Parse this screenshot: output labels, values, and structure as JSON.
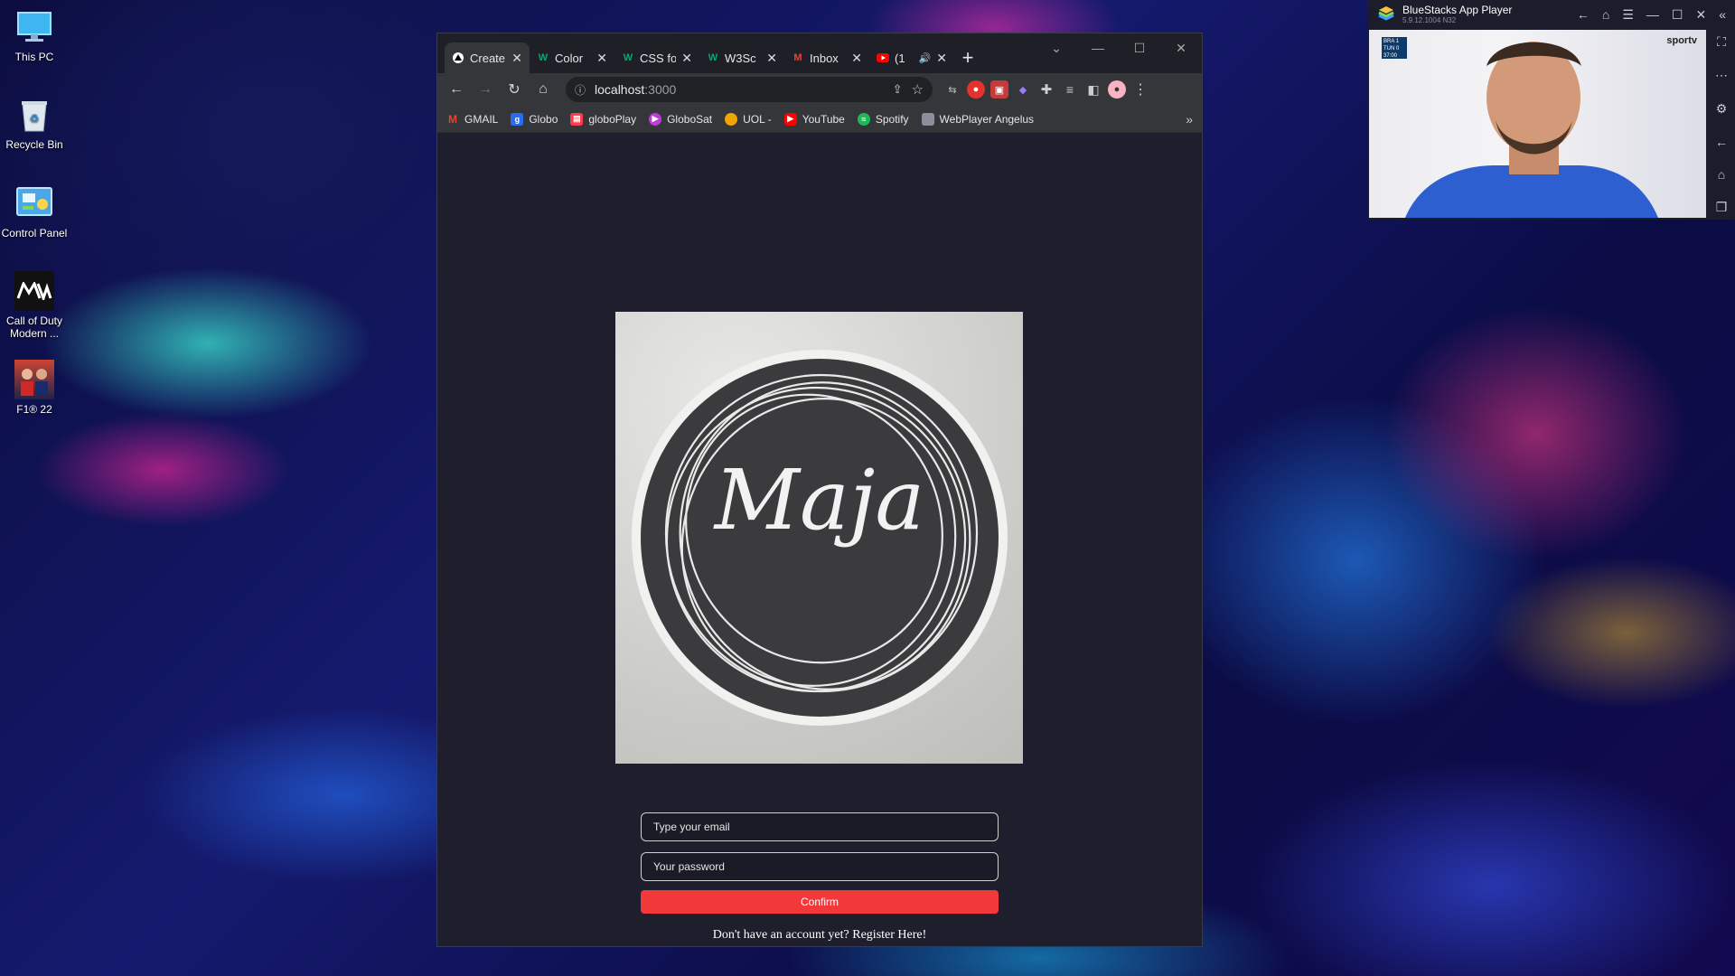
{
  "desktop": {
    "icons": [
      {
        "label": "This PC",
        "icon": "monitor-icon"
      },
      {
        "label": "Recycle Bin",
        "icon": "recycle-bin-icon"
      },
      {
        "label": "Control Panel",
        "icon": "control-panel-icon"
      },
      {
        "label": "Call of Duty Modern ...",
        "icon": "game-icon"
      },
      {
        "label": "F1® 22",
        "icon": "game-icon"
      }
    ]
  },
  "browser": {
    "tabs": [
      {
        "title": "Create",
        "active": true
      },
      {
        "title": "Color"
      },
      {
        "title": "CSS fo"
      },
      {
        "title": "W3Sc"
      },
      {
        "title": "Inbox"
      },
      {
        "title": "(1"
      }
    ],
    "new_tab": "+",
    "url_host": "localhost",
    "url_port": ":3000",
    "bookmarks": [
      {
        "label": "GMAIL",
        "color": "#ea4335"
      },
      {
        "label": "Globo",
        "color": "#2a6cf0"
      },
      {
        "label": "globoPlay",
        "color": "#ff3b4e"
      },
      {
        "label": "GloboSat",
        "color": "#c03cd8"
      },
      {
        "label": "UOL -",
        "color": "#f2a400"
      },
      {
        "label": "YouTube",
        "color": "#ff0000"
      },
      {
        "label": "Spotify",
        "color": "#1db954"
      },
      {
        "label": "WebPlayer Angelus",
        "color": "#8a8f99"
      }
    ],
    "more": "»"
  },
  "login": {
    "logo_text": "Maja",
    "email_placeholder": "Type your email",
    "password_placeholder": "Your password",
    "confirm_label": "Confirm",
    "register_text": "Don't have an account yet? Register Here!",
    "accent": "#f2383a"
  },
  "bluestacks": {
    "title": "BlueStacks App Player",
    "version": "5.9.12.1004 N32",
    "channel": "sportv",
    "score_lines": [
      "BRA 1",
      "TUN 0",
      "37:00"
    ]
  }
}
